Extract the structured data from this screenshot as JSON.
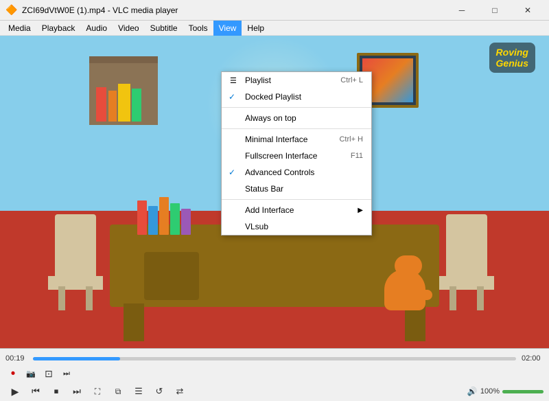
{
  "titleBar": {
    "icon": "🔶",
    "title": "ZCI69dVtW0E (1).mp4 - VLC media player",
    "minimizeBtn": "─",
    "maximizeBtn": "□",
    "closeBtn": "✕"
  },
  "menuBar": {
    "items": [
      {
        "id": "media",
        "label": "Media"
      },
      {
        "id": "playback",
        "label": "Playback"
      },
      {
        "id": "audio",
        "label": "Audio"
      },
      {
        "id": "video",
        "label": "Video"
      },
      {
        "id": "subtitle",
        "label": "Subtitle"
      },
      {
        "id": "tools",
        "label": "Tools"
      },
      {
        "id": "view",
        "label": "View",
        "active": true
      },
      {
        "id": "help",
        "label": "Help"
      }
    ]
  },
  "viewMenu": {
    "items": [
      {
        "id": "playlist",
        "label": "Playlist",
        "shortcut": "Ctrl+ L",
        "check": "",
        "separator": false,
        "arrow": false
      },
      {
        "id": "docked-playlist",
        "label": "Docked Playlist",
        "shortcut": "",
        "check": "✓",
        "separator": false,
        "arrow": false
      },
      {
        "id": "always-on-top",
        "label": "Always on top",
        "shortcut": "",
        "check": "",
        "separator": true,
        "arrow": false
      },
      {
        "id": "minimal-interface",
        "label": "Minimal Interface",
        "shortcut": "Ctrl+ H",
        "check": "",
        "separator": false,
        "arrow": false
      },
      {
        "id": "fullscreen-interface",
        "label": "Fullscreen Interface",
        "shortcut": "F11",
        "check": "",
        "separator": false,
        "arrow": false
      },
      {
        "id": "advanced-controls",
        "label": "Advanced Controls",
        "shortcut": "",
        "check": "✓",
        "separator": false,
        "arrow": false
      },
      {
        "id": "status-bar",
        "label": "Status Bar",
        "shortcut": "",
        "check": "",
        "separator": true,
        "arrow": false
      },
      {
        "id": "add-interface",
        "label": "Add Interface",
        "shortcut": "",
        "check": "",
        "separator": false,
        "arrow": "▶"
      },
      {
        "id": "vlsub",
        "label": "VLsub",
        "shortcut": "",
        "check": "",
        "separator": false,
        "arrow": false
      }
    ]
  },
  "logo": {
    "line1": "Roving",
    "line2": "Genius"
  },
  "controls": {
    "timeElapsed": "00:19",
    "timeTotal": "02:00",
    "progressPercent": 18,
    "volumePercent": 100,
    "volumeLabel": "100%",
    "extraButtons": [
      {
        "id": "record",
        "icon": "⏺",
        "label": "Record"
      },
      {
        "id": "snapshot",
        "icon": "📷",
        "label": "Snapshot"
      },
      {
        "id": "loop-ab",
        "icon": "⊡",
        "label": "Loop A-B"
      },
      {
        "id": "frame-next",
        "icon": "⏭",
        "label": "Frame by frame"
      }
    ],
    "mainButtons": [
      {
        "id": "play",
        "icon": "▶",
        "label": "Play"
      },
      {
        "id": "prev",
        "icon": "⏮",
        "label": "Previous"
      },
      {
        "id": "stop",
        "icon": "⏹",
        "label": "Stop"
      },
      {
        "id": "next",
        "icon": "⏭",
        "label": "Next"
      },
      {
        "id": "fullscreen",
        "icon": "⛶",
        "label": "Fullscreen"
      },
      {
        "id": "ext-settings",
        "icon": "⧉",
        "label": "Extended settings"
      },
      {
        "id": "show-playlist",
        "icon": "☰",
        "label": "Show playlist"
      },
      {
        "id": "loop",
        "icon": "↺",
        "label": "Loop"
      },
      {
        "id": "random",
        "icon": "⇄",
        "label": "Random"
      }
    ]
  }
}
